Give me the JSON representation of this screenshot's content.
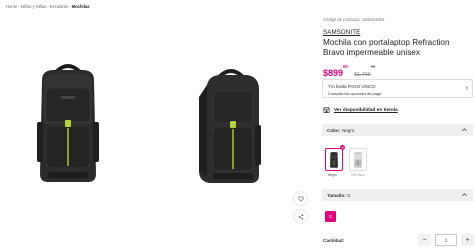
{
  "breadcrumb": [
    "Home",
    "Niños y Niñas",
    "Escolares",
    "Mochilas"
  ],
  "product": {
    "sku_text": "Código de producto: 1195323451",
    "brand": "SAMSONITE",
    "title": "Mochila con portalaptop Refraction Bravo impermeable unisex",
    "price_current_main": "$899",
    "price_current_cents": "00",
    "price_old_main": "$1,799",
    "price_old_cents": "00"
  },
  "payment": {
    "line1": "Y/o hasta PAGO ÚNICO",
    "line2": "Consulta las opciones de pago"
  },
  "store_link": "Ver disponibilidad en tienda",
  "color_section": {
    "label": "Color:",
    "value": "Negro",
    "options": [
      {
        "name": "Negro",
        "selected": true
      },
      {
        "name": "Gris claro",
        "selected": false
      }
    ]
  },
  "size_section": {
    "label": "Tamaño:",
    "value": "G",
    "options": [
      {
        "name": "G",
        "selected": true
      }
    ]
  },
  "quantity": {
    "label": "Cantidad:",
    "value": "1",
    "minus": "−",
    "plus": "+"
  },
  "colors": {
    "accent": "#e4007c",
    "bag_body": "#2b2b2b",
    "bag_accent": "#b5d334"
  }
}
